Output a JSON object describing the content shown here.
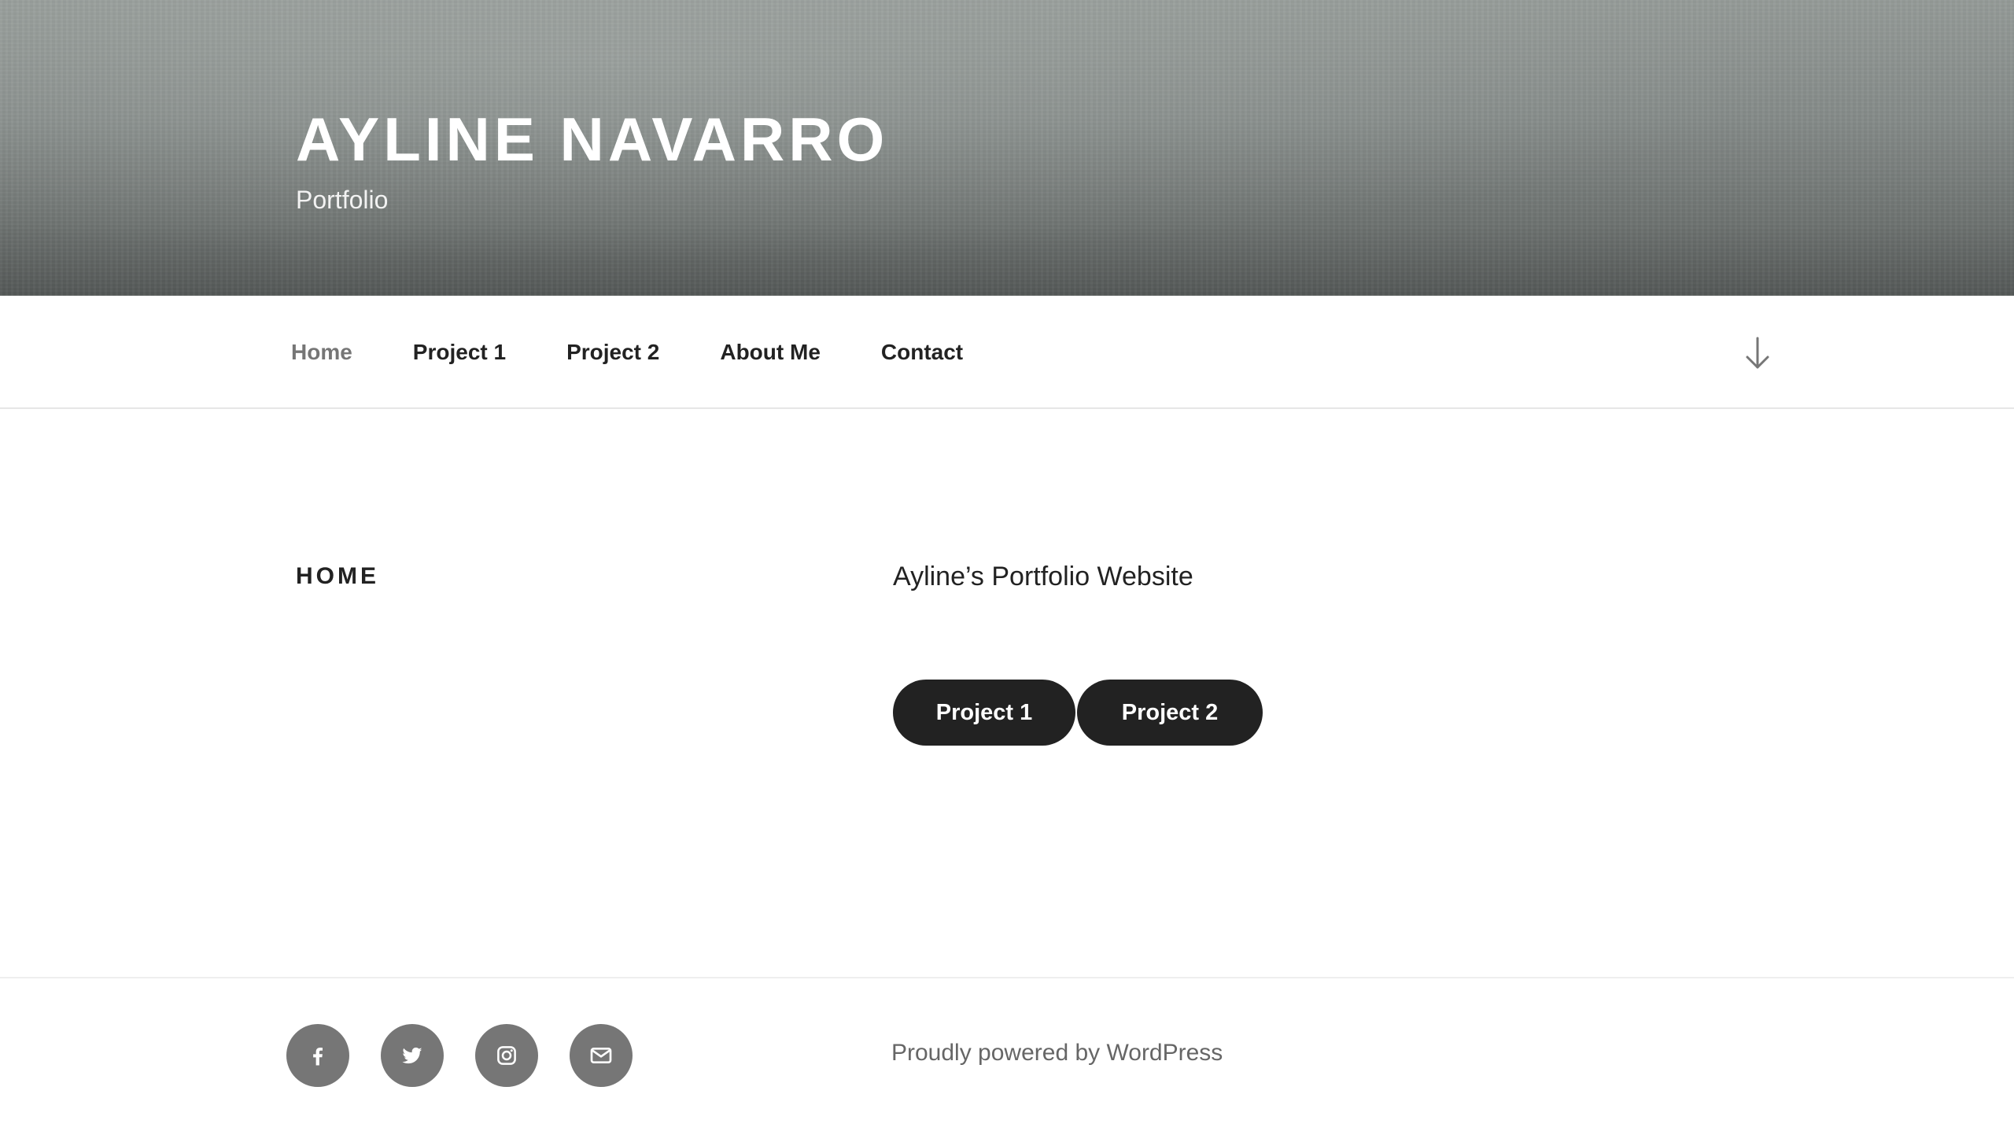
{
  "header": {
    "site_title": "AYLINE NAVARRO",
    "site_description": "Portfolio"
  },
  "nav": {
    "items": [
      {
        "label": "Home",
        "current": true
      },
      {
        "label": "Project 1",
        "current": false
      },
      {
        "label": "Project 2",
        "current": false
      },
      {
        "label": "About Me",
        "current": false
      },
      {
        "label": "Contact",
        "current": false
      }
    ],
    "scroll_icon": "arrow-down-icon"
  },
  "main": {
    "page_title": "HOME",
    "intro": "Ayline’s Portfolio Website",
    "buttons": [
      {
        "label": "Project 1"
      },
      {
        "label": "Project 2"
      }
    ]
  },
  "footer": {
    "social_icons": [
      "facebook-icon",
      "twitter-icon",
      "instagram-icon",
      "email-icon"
    ],
    "powered_by": "Proudly powered by WordPress"
  },
  "colors": {
    "text": "#222222",
    "nav_current": "#767676",
    "button_bg": "#222222",
    "social_bg": "#767676",
    "footer_text": "#666666"
  }
}
